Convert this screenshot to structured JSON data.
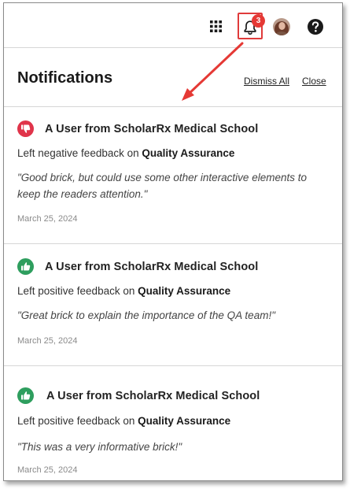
{
  "topbar": {
    "icons": [
      "apps-grid-icon",
      "bell-icon",
      "avatar",
      "help-icon"
    ],
    "badge_count": "3",
    "colors": {
      "badge": "#e53935",
      "highlight_box": "#e03b3b"
    }
  },
  "header": {
    "title": "Notifications",
    "dismiss_all": "Dismiss All",
    "close": "Close"
  },
  "notifications": [
    {
      "sentiment": "negative",
      "icon": "thumbs-down-icon",
      "icon_color": "#e0344a",
      "sender": "A User from ScholarRx Medical School",
      "desc_prefix": "Left negative feedback on",
      "desc_target": "Quality Assurance",
      "quote": "\"Good brick, but could use some other interactive elements to keep the readers attention.\"",
      "date": "March 25, 2024"
    },
    {
      "sentiment": "positive",
      "icon": "thumbs-up-icon",
      "icon_color": "#2e9e5e",
      "sender": "A User from ScholarRx Medical School",
      "desc_prefix": "Left positive feedback on",
      "desc_target": "Quality Assurance",
      "quote": "\"Great brick to explain the importance of the QA team!\"",
      "date": "March 25, 2024"
    },
    {
      "sentiment": "positive",
      "icon": "thumbs-up-icon",
      "icon_color": "#2e9e5e",
      "sender": "A User from ScholarRx Medical School",
      "desc_prefix": "Left positive feedback on",
      "desc_target": "Quality Assurance",
      "quote": "\"This was a very informative brick!\"",
      "date": "March 25, 2024"
    }
  ],
  "annotation": {
    "arrow_color": "#e53935"
  }
}
